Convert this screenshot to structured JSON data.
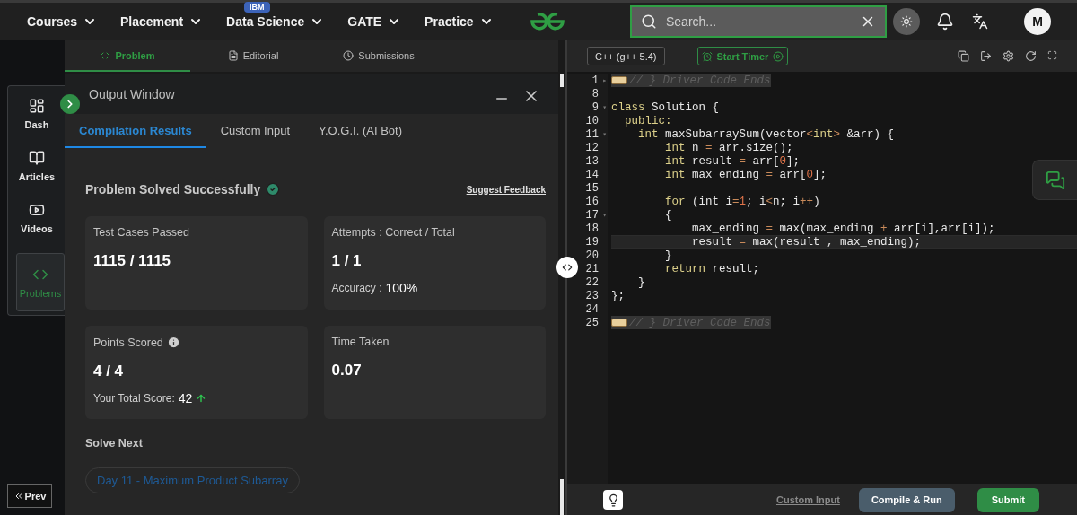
{
  "nav": {
    "menus": [
      {
        "label": "Courses"
      },
      {
        "label": "Placement"
      },
      {
        "label": "Data Science",
        "badge": "IBM"
      },
      {
        "label": "GATE"
      },
      {
        "label": "Practice"
      }
    ],
    "search": {
      "placeholder": "Search..."
    },
    "avatar": "M"
  },
  "sidebar": {
    "items": [
      {
        "label": "Dash",
        "kind": "dashboard",
        "selected": false
      },
      {
        "label": "Articles",
        "kind": "book",
        "selected": false
      },
      {
        "label": "Videos",
        "kind": "video",
        "selected": false
      },
      {
        "label": "Problems",
        "kind": "code",
        "selected": true
      }
    ],
    "prev_button": "Prev"
  },
  "problem_tabs": [
    {
      "label": "Problem",
      "kind": "code",
      "selected": true
    },
    {
      "label": "Editorial",
      "kind": "document",
      "selected": false
    },
    {
      "label": "Submissions",
      "kind": "clock",
      "selected": false
    }
  ],
  "output_window": {
    "title": "Output Window",
    "tabs": [
      {
        "label": "Compilation Results",
        "selected": true
      },
      {
        "label": "Custom Input",
        "selected": false
      },
      {
        "label": "Y.O.G.I. (AI Bot)",
        "selected": false
      }
    ],
    "status": "Problem Solved Successfully",
    "feedback_link": "Suggest Feedback",
    "cards": [
      {
        "label": "Test Cases Passed",
        "value": "1115 / 1115"
      },
      {
        "label": "Attempts : Correct / Total",
        "value": "1 / 1",
        "note_label": "Accuracy :",
        "note_value": "100%"
      },
      {
        "label": "Points Scored",
        "info": true,
        "value": "4 / 4",
        "note_label": "Your Total Score:",
        "note_value": "42",
        "rising": true
      },
      {
        "label": "Time Taken",
        "value": "0.07"
      }
    ],
    "solve_next": {
      "heading": "Solve Next",
      "items": [
        "Day 11 - Maximum Product Subarray"
      ]
    }
  },
  "editor": {
    "language": "C++ (g++ 5.4)",
    "timer_button": "Start Timer",
    "lines": [
      {
        "number": "1",
        "fold_marker": "▸",
        "active": false,
        "kind": "folded",
        "tokens": [
          {
            "kind": "comment",
            "text": "// } Driver Code Ends"
          }
        ]
      },
      {
        "number": "8",
        "active": false,
        "kind": "code"
      },
      {
        "number": "9",
        "fold_marker": "▾",
        "active": false,
        "kind": "code",
        "tokens": [
          {
            "kind": "kw",
            "text": "class"
          },
          {
            "kind": "id",
            "text": " Solution {"
          }
        ]
      },
      {
        "number": "10",
        "active": false,
        "kind": "code",
        "tokens": [
          {
            "kind": "kw",
            "text": "  public:"
          }
        ]
      },
      {
        "number": "11",
        "fold_marker": "▾",
        "active": false,
        "kind": "code",
        "tokens": [
          {
            "kind": "kw",
            "text": "    int"
          },
          {
            "kind": "id",
            "text": " maxSubarraySum(vector"
          },
          {
            "kind": "op",
            "text": "<"
          },
          {
            "kind": "kw",
            "text": "int"
          },
          {
            "kind": "op",
            "text": ">"
          },
          {
            "kind": "id",
            "text": " &arr) {"
          }
        ]
      },
      {
        "number": "12",
        "active": false,
        "kind": "code",
        "tokens": [
          {
            "kind": "kw",
            "text": "        int"
          },
          {
            "kind": "id",
            "text": " n "
          },
          {
            "kind": "op",
            "text": "="
          },
          {
            "kind": "id",
            "text": " arr.size();"
          }
        ]
      },
      {
        "number": "13",
        "active": false,
        "kind": "code",
        "tokens": [
          {
            "kind": "kw",
            "text": "        int"
          },
          {
            "kind": "id",
            "text": " result "
          },
          {
            "kind": "op",
            "text": "="
          },
          {
            "kind": "id",
            "text": " arr["
          },
          {
            "kind": "num",
            "text": "0"
          },
          {
            "kind": "id",
            "text": "];"
          }
        ]
      },
      {
        "number": "14",
        "active": false,
        "kind": "code",
        "tokens": [
          {
            "kind": "kw",
            "text": "        int"
          },
          {
            "kind": "id",
            "text": " max_ending "
          },
          {
            "kind": "op",
            "text": "="
          },
          {
            "kind": "id",
            "text": " arr["
          },
          {
            "kind": "num",
            "text": "0"
          },
          {
            "kind": "id",
            "text": "];"
          }
        ]
      },
      {
        "number": "15",
        "active": false,
        "kind": "code"
      },
      {
        "number": "16",
        "active": false,
        "kind": "code",
        "tokens": [
          {
            "kind": "kw",
            "text": "        for"
          },
          {
            "kind": "id",
            "text": " (int i"
          },
          {
            "kind": "op",
            "text": "="
          },
          {
            "kind": "num",
            "text": "1"
          },
          {
            "kind": "id",
            "text": "; i"
          },
          {
            "kind": "op",
            "text": "<"
          },
          {
            "kind": "id",
            "text": "n; i"
          },
          {
            "kind": "op",
            "text": "++"
          },
          {
            "kind": "id",
            "text": ")"
          }
        ]
      },
      {
        "number": "17",
        "fold_marker": "▾",
        "active": false,
        "kind": "code",
        "tokens": [
          {
            "kind": "id",
            "text": "        {"
          }
        ]
      },
      {
        "number": "18",
        "active": false,
        "kind": "code",
        "tokens": [
          {
            "kind": "id",
            "text": "            max_ending "
          },
          {
            "kind": "op",
            "text": "="
          },
          {
            "kind": "id",
            "text": " max(max_ending "
          },
          {
            "kind": "op",
            "text": "+"
          },
          {
            "kind": "id",
            "text": " arr[i],arr[i]);"
          }
        ]
      },
      {
        "number": "19",
        "active": true,
        "kind": "code",
        "tokens": [
          {
            "kind": "id",
            "text": "            result "
          },
          {
            "kind": "op",
            "text": "="
          },
          {
            "kind": "id",
            "text": " max(result , max_ending);"
          }
        ]
      },
      {
        "number": "20",
        "active": false,
        "kind": "code",
        "tokens": [
          {
            "kind": "id",
            "text": "        }"
          }
        ]
      },
      {
        "number": "21",
        "active": false,
        "kind": "code",
        "tokens": [
          {
            "kind": "kw",
            "text": "        return"
          },
          {
            "kind": "id",
            "text": " result;"
          }
        ]
      },
      {
        "number": "22",
        "active": false,
        "kind": "code",
        "tokens": [
          {
            "kind": "id",
            "text": "    }"
          }
        ]
      },
      {
        "number": "23",
        "active": false,
        "kind": "code",
        "tokens": [
          {
            "kind": "id",
            "text": "};"
          }
        ]
      },
      {
        "number": "24",
        "active": false,
        "kind": "code"
      },
      {
        "number": "25",
        "active": false,
        "kind": "folded",
        "tokens": [
          {
            "kind": "comment",
            "text": "// } Driver Code Ends"
          }
        ]
      }
    ],
    "custom_input_link": "Custom Input",
    "compile_button": "Compile & Run",
    "submit_button": "Submit"
  }
}
